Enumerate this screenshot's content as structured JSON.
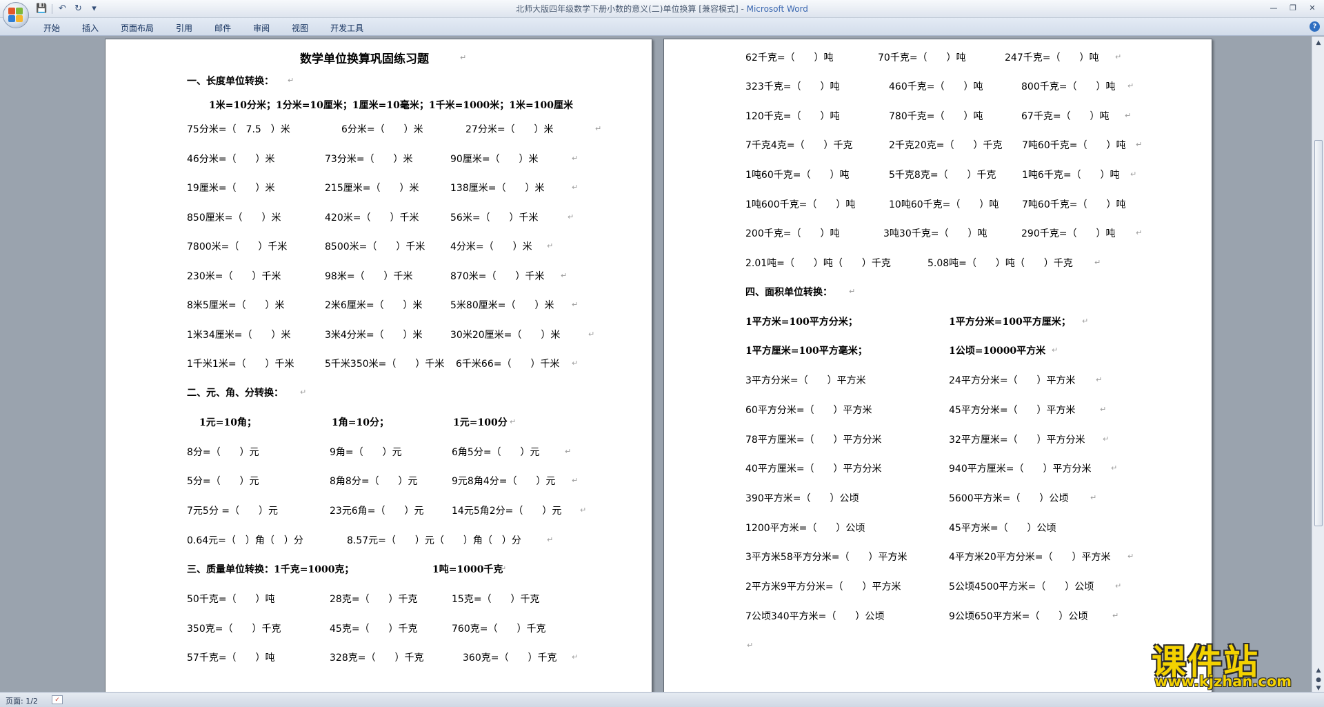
{
  "window": {
    "title": "北师大版四年级数学下册小数的意义(二)单位换算 [兼容模式] - ",
    "app_name": "Microsoft Word",
    "controls": [
      "—",
      "❐",
      "✕"
    ]
  },
  "quick_access": {
    "save_icon": "💾",
    "undo_icon": "↶",
    "redo_icon": "↻",
    "more_icon": "▾"
  },
  "ribbon": {
    "tabs": [
      "开始",
      "插入",
      "页面布局",
      "引用",
      "邮件",
      "审阅",
      "视图",
      "开发工具"
    ],
    "help": "?"
  },
  "document": {
    "paragraph_mark": "↵",
    "left_page": {
      "title": "数学单位换算巩固练习题",
      "sec1_title": "一、长度单位转换：",
      "sec1_rule": "1米=10分米；1分米=10厘米；1厘米=10毫米；1千米=1000米；1米=100厘米",
      "sec1_rows": [
        [
          "75分米=（　7.5　）米",
          "6分米=（　　）米",
          "27分米=（　　）米"
        ],
        [
          "46分米=（　　）米",
          "73分米=（　　）米",
          "90厘米=（　　）米"
        ],
        [
          "19厘米=（　　）米",
          "215厘米=（　　）米",
          "138厘米=（　　）米"
        ],
        [
          "850厘米=（　　）米",
          "420米=（　　）千米",
          "56米=（　　）千米"
        ],
        [
          "7800米=（　　）千米",
          "8500米=（　　）千米",
          "4分米=（　　）米"
        ],
        [
          "230米=（　　）千米",
          "98米=（　　）千米",
          "870米=（　　）千米"
        ],
        [
          "8米5厘米=（　　）米",
          "2米6厘米=（　　）米",
          "5米80厘米=（　　）米"
        ],
        [
          "1米34厘米=（　　）米",
          "3米4分米=（　　）米",
          "30米20厘米=（　　）米"
        ],
        [
          "1千米1米=（　　）千米",
          "5千米350米=（　　）千米",
          "6千米66=（　　）千米"
        ]
      ],
      "sec2_title": "二、元、角、分转换：",
      "sec2_rules": [
        "1元=10角；",
        "1角=10分；",
        "1元=100分"
      ],
      "sec2_rows": [
        [
          "8分=（　　）元",
          "9角=（　　）元",
          "6角5分=（　　）元"
        ],
        [
          "5分=（　　）元",
          "8角8分=（　　）元",
          "9元8角4分=（　　）元"
        ],
        [
          "7元5分 =（　　）元",
          "23元6角=（　　）元",
          "14元5角2分=（　　）元"
        ]
      ],
      "sec2_row4": [
        "0.64元=（　）角（　）分",
        "8.57元=（　　）元（　　）角（　）分"
      ],
      "sec3_title": "三、质量单位转换：1千克=1000克；",
      "sec3_rule2": "1吨=1000千克",
      "sec3_rows": [
        [
          "50千克=（　　）吨",
          "28克=（　　）千克",
          "15克=（　　）千克"
        ],
        [
          "350克=（　　）千克",
          "45克=（　　）千克",
          "760克=（　　）千克"
        ],
        [
          "57千克=（　　）吨",
          "328克=（　　）千克",
          "360克=（　　）千克"
        ]
      ]
    },
    "right_page": {
      "mass_rows": [
        [
          "62千克=（　　）吨",
          "70千克=（　　）吨",
          "247千克=（　　）吨"
        ],
        [
          "323千克=（　　）吨",
          "460千克=（　　）吨",
          "800千克=（　　）吨"
        ],
        [
          "120千克=（　　）吨",
          "780千克=（　　）吨",
          "67千克=（　　）吨"
        ],
        [
          "7千克4克=（　　）千克",
          "2千克20克=（　　）千克",
          "7吨60千克=（　　）吨"
        ],
        [
          "1吨60千克=（　　）吨",
          "5千克8克=（　　）千克",
          "1吨6千克=（　　）吨"
        ],
        [
          "1吨600千克=（　　）吨",
          "10吨60千克=（　　）吨",
          "7吨60千克=（　　）吨"
        ],
        [
          "200千克=（　　）吨",
          "3吨30千克=（　　）吨",
          "290千克=（　　）吨"
        ]
      ],
      "mass_row8": [
        "2.01吨=（　　）吨（　　）千克",
        "5.08吨=（　　）吨（　　）千克"
      ],
      "sec4_title": "四、面积单位转换：",
      "sec4_rules": [
        [
          "1平方米=100平方分米；",
          "1平方分米=100平方厘米；"
        ],
        [
          "1平方厘米=100平方毫米；",
          "1公顷=10000平方米"
        ]
      ],
      "sec4_rows": [
        [
          "3平方分米=（　　）平方米",
          "24平方分米=（　　）平方米"
        ],
        [
          "60平方分米=（　　）平方米",
          "45平方分米=（　　）平方米"
        ],
        [
          "78平方厘米=（　　）平方分米",
          "32平方厘米=（　　）平方分米"
        ],
        [
          "40平方厘米=（　　）平方分米",
          "940平方厘米=（　　）平方分米"
        ],
        [
          "390平方米=（　　）公顷",
          "5600平方米=（　　）公顷"
        ],
        [
          "1200平方米=（　　）公顷",
          "45平方米=（　　）公顷"
        ],
        [
          "3平方米58平方分米=（　　）平方米",
          "4平方米20平方分米=（　　）平方米"
        ],
        [
          "2平方米9平方分米=（　　）平方米",
          "5公顷4500平方米=（　　）公顷"
        ],
        [
          "7公顷340平方米=（　　）公顷",
          "9公顷650平方米=（　　）公顷"
        ]
      ]
    }
  },
  "statusbar": {
    "page_info": "页面: 1/2",
    "spell_icon": "✓"
  },
  "watermark": {
    "text_cn": "课件站",
    "url": "www.kjzhan.com"
  }
}
